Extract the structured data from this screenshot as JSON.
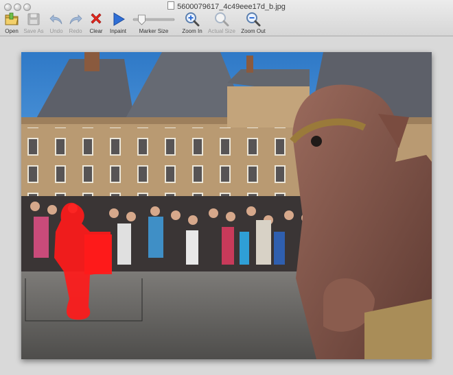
{
  "window": {
    "title": "5600079617_4c49eee17d_b.jpg"
  },
  "toolbar": {
    "tools": [
      {
        "id": "open",
        "label": "Open",
        "icon": "folder-icon",
        "enabled": true
      },
      {
        "id": "save-as",
        "label": "Save As",
        "icon": "floppy-disk-icon",
        "enabled": false
      },
      {
        "id": "undo",
        "label": "Undo",
        "icon": "undo-arrow-icon",
        "enabled": false
      },
      {
        "id": "redo",
        "label": "Redo",
        "icon": "redo-arrow-icon",
        "enabled": false
      },
      {
        "id": "clear",
        "label": "Clear",
        "icon": "red-x-icon",
        "enabled": true
      },
      {
        "id": "inpaint",
        "label": "Inpaint",
        "icon": "play-triangle-icon",
        "enabled": true
      },
      {
        "id": "marker-size",
        "label": "Marker Size",
        "icon": "slider",
        "enabled": true
      },
      {
        "id": "zoom-in",
        "label": "Zoom In",
        "icon": "magnifier-plus-icon",
        "enabled": true
      },
      {
        "id": "actual-size",
        "label": "Actual Size",
        "icon": "magnifier-icon",
        "enabled": false
      },
      {
        "id": "zoom-out",
        "label": "Zoom Out",
        "icon": "magnifier-minus-icon",
        "enabled": true
      }
    ],
    "marker_size_level": 0.15
  },
  "colors": {
    "mask": "#ff1a1a",
    "sky": "#3b86d0",
    "accent_blue": "#2f6fd6"
  }
}
